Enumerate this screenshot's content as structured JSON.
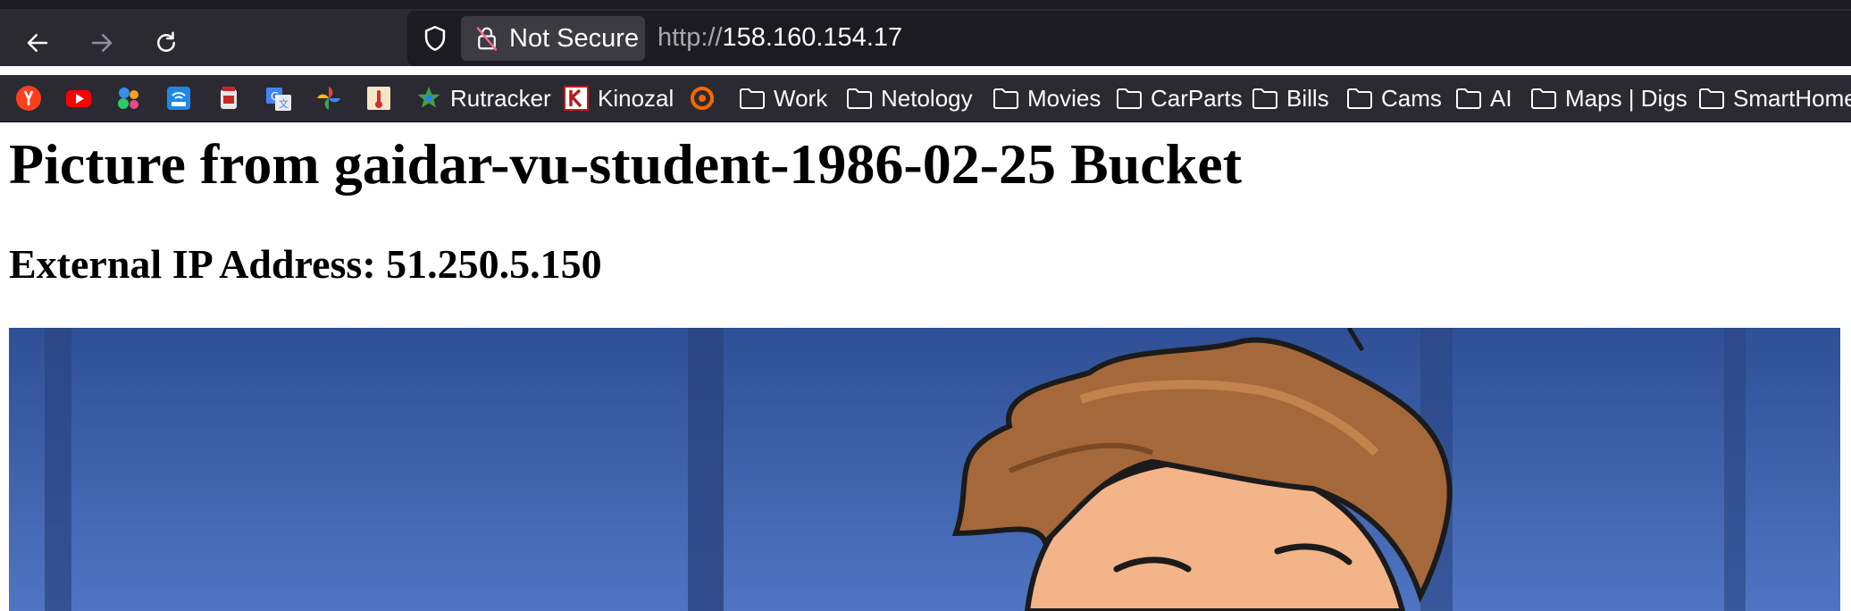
{
  "browser": {
    "back_icon": "arrow-left-icon",
    "forward_icon": "arrow-right-icon",
    "reload_icon": "reload-icon",
    "security_label": "Not Secure",
    "url_scheme": "http://",
    "url_host": "158.160.154.17"
  },
  "bookmarks": [
    {
      "label": "",
      "icon": "yandex-icon"
    },
    {
      "label": "",
      "icon": "youtube-icon"
    },
    {
      "label": "",
      "icon": "bubbles-icon"
    },
    {
      "label": "",
      "icon": "router-icon"
    },
    {
      "label": "",
      "icon": "jar-icon"
    },
    {
      "label": "",
      "icon": "translate-icon"
    },
    {
      "label": "",
      "icon": "pinwheel-icon"
    },
    {
      "label": "",
      "icon": "thermometer-icon"
    },
    {
      "label": "Rutracker",
      "icon": "rutracker-icon"
    },
    {
      "label": "Kinozal",
      "icon": "kinozal-icon"
    },
    {
      "label": "",
      "icon": "grafana-icon"
    },
    {
      "label": "Work",
      "icon": "folder-icon"
    },
    {
      "label": "Netology",
      "icon": "folder-icon"
    },
    {
      "label": "Movies",
      "icon": "folder-icon"
    },
    {
      "label": "CarParts",
      "icon": "folder-icon"
    },
    {
      "label": "Bills",
      "icon": "folder-icon"
    },
    {
      "label": "Cams",
      "icon": "folder-icon"
    },
    {
      "label": "AI",
      "icon": "folder-icon"
    },
    {
      "label": "Maps | Digs",
      "icon": "folder-icon"
    },
    {
      "label": "SmartHome",
      "icon": "folder-icon"
    }
  ],
  "page": {
    "title": "Picture from gaidar-vu-student-1986-02-25 Bucket",
    "subtitle": "External IP Address: 51.250.5.150",
    "image_subject": "cartoon-student-illustration"
  },
  "colors": {
    "chrome_bg": "#2b2a33",
    "urlbar_bg": "#1c1b22",
    "picture_blue": "#3f66b5"
  }
}
